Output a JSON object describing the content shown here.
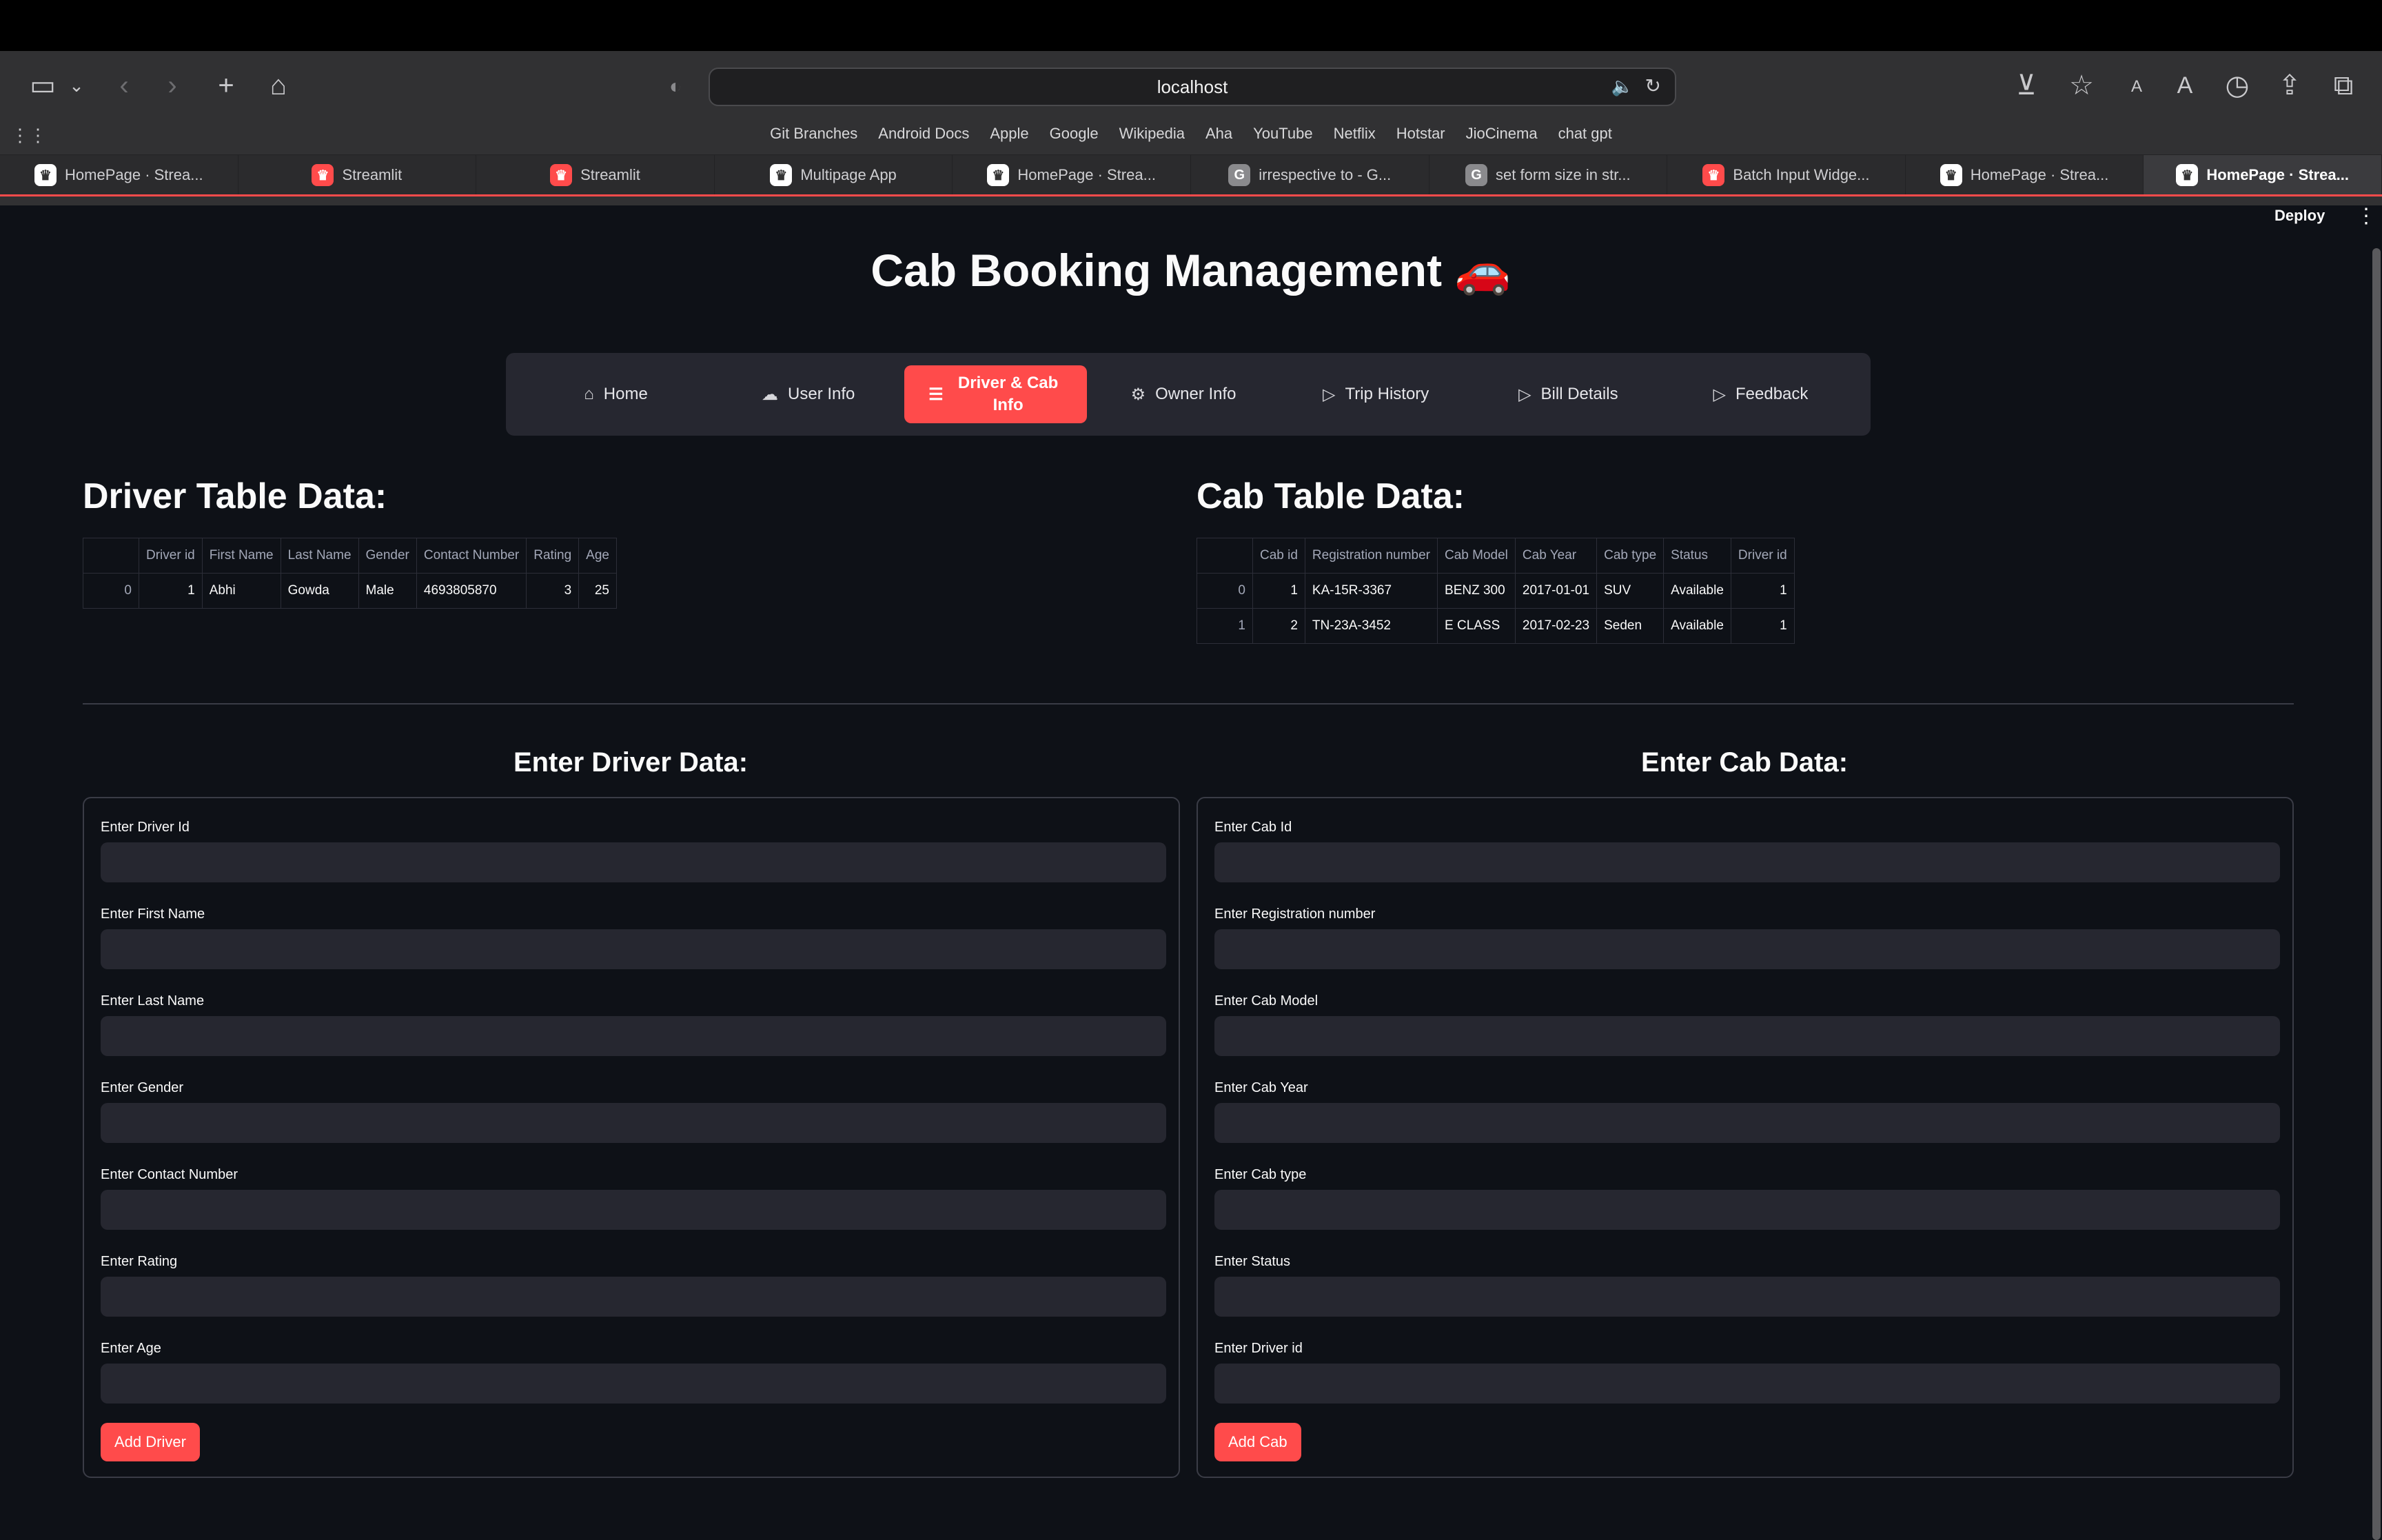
{
  "browser": {
    "url": "localhost",
    "bookmarks": [
      "Git Branches",
      "Android Docs",
      "Apple",
      "Google",
      "Wikipedia",
      "Aha",
      "YouTube",
      "Netflix",
      "Hotstar",
      "JioCinema",
      "chat gpt"
    ],
    "tabs": [
      {
        "label": "HomePage · Strea...",
        "icon": "streamlit-crown-icon"
      },
      {
        "label": "Streamlit",
        "icon": "streamlit-red-icon"
      },
      {
        "label": "Streamlit",
        "icon": "streamlit-red-icon"
      },
      {
        "label": "Multipage App",
        "icon": "streamlit-crown-icon"
      },
      {
        "label": "HomePage · Strea...",
        "icon": "streamlit-crown-icon"
      },
      {
        "label": "irrespective to - G...",
        "icon": "g-icon"
      },
      {
        "label": "set form size in str...",
        "icon": "g-icon"
      },
      {
        "label": "Batch Input Widge...",
        "icon": "streamlit-red-icon"
      },
      {
        "label": "HomePage · Strea...",
        "icon": "streamlit-crown-icon"
      },
      {
        "label": "HomePage · Strea...",
        "icon": "streamlit-crown-icon",
        "active": true
      }
    ]
  },
  "app": {
    "deploy_label": "Deploy",
    "title": "Cab Booking Management 🚗",
    "nav": [
      {
        "label": "Home",
        "icon": "⌂"
      },
      {
        "label": "User Info",
        "icon": "☁"
      },
      {
        "label": "Driver & Cab Info",
        "icon": "☰",
        "active": true
      },
      {
        "label": "Owner Info",
        "icon": "⚙"
      },
      {
        "label": "Trip History",
        "icon": "▷"
      },
      {
        "label": "Bill Details",
        "icon": "▷"
      },
      {
        "label": "Feedback",
        "icon": "▷"
      }
    ],
    "driver_table": {
      "title": "Driver Table Data:",
      "columns": [
        "",
        "Driver id",
        "First Name",
        "Last Name",
        "Gender",
        "Contact Number",
        "Rating",
        "Age"
      ],
      "rows": [
        [
          "0",
          "1",
          "Abhi",
          "Gowda",
          "Male",
          "4693805870",
          "3",
          "25"
        ]
      ]
    },
    "cab_table": {
      "title": "Cab Table Data:",
      "columns": [
        "",
        "Cab id",
        "Registration number",
        "Cab Model",
        "Cab Year",
        "Cab type",
        "Status",
        "Driver id"
      ],
      "rows": [
        [
          "0",
          "1",
          "KA-15R-3367",
          "BENZ 300",
          "2017-01-01",
          "SUV",
          "Available",
          "1"
        ],
        [
          "1",
          "2",
          "TN-23A-3452",
          "E CLASS",
          "2017-02-23",
          "Seden",
          "Available",
          "1"
        ]
      ]
    },
    "driver_form": {
      "title": "Enter Driver Data:",
      "fields": [
        "Enter Driver Id",
        "Enter First Name",
        "Enter Last Name",
        "Enter Gender",
        "Enter Contact Number",
        "Enter Rating",
        "Enter Age"
      ],
      "values": [
        "",
        "",
        "",
        "",
        "",
        "",
        ""
      ],
      "button": "Add Driver"
    },
    "cab_form": {
      "title": "Enter Cab Data:",
      "fields": [
        "Enter Cab Id",
        "Enter Registration number",
        "Enter Cab Model",
        "Enter Cab Year",
        "Enter Cab type",
        "Enter Status",
        "Enter Driver id"
      ],
      "values": [
        "",
        "",
        "",
        "",
        "",
        "",
        ""
      ],
      "button": "Add Cab"
    }
  }
}
